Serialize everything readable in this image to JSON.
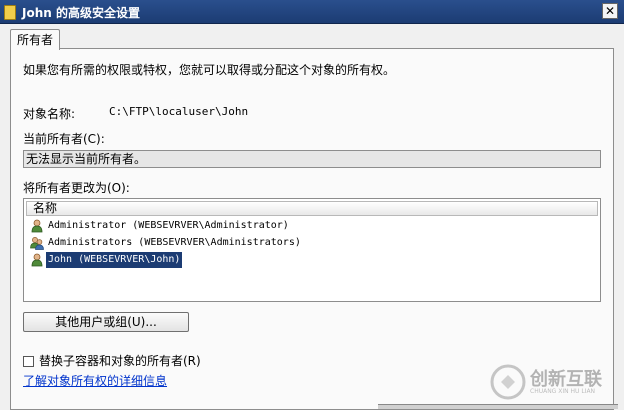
{
  "window": {
    "title": "John 的高级安全设置",
    "close_glyph": "✕"
  },
  "tabs": [
    {
      "label": "所有者"
    }
  ],
  "panel": {
    "intro": "如果您有所需的权限或特权，您就可以取得或分配这个对象的所有权。",
    "object_name_label": "对象名称:",
    "object_name_value": "C:\\FTP\\localuser\\John",
    "current_owner_label": "当前所有者(C):",
    "current_owner_value": "无法显示当前所有者。",
    "change_owner_label": "将所有者更改为(O):",
    "list": {
      "column_header": "名称",
      "items": [
        {
          "label": "Administrator (WEBSEVRVER\\Administrator)",
          "icon": "user-icon",
          "selected": false
        },
        {
          "label": "Administrators (WEBSEVRVER\\Administrators)",
          "icon": "group-icon",
          "selected": false
        },
        {
          "label": "John (WEBSEVRVER\\John)",
          "icon": "user-icon",
          "selected": true
        }
      ]
    },
    "other_users_button": "其他用户或组(U)...",
    "replace_checkbox_label": "替换子容器和对象的所有者(R)",
    "replace_checked": false,
    "learn_more_link": "了解对象所有权的详细信息"
  },
  "watermark": {
    "logo": "创新互联",
    "subtext": "CHUANG XIN HU LIAN"
  }
}
